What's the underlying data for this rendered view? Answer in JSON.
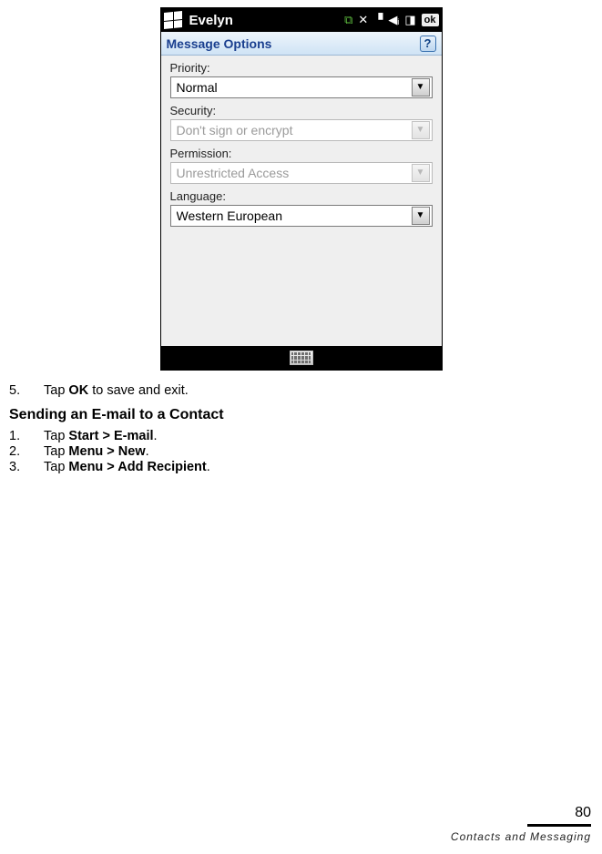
{
  "device": {
    "statusbar": {
      "title": "Evelyn",
      "ok": "ok"
    },
    "titlebar": {
      "title": "Message Options",
      "help": "?"
    },
    "fields": {
      "priority": {
        "label": "Priority:",
        "value": "Normal",
        "enabled": true
      },
      "security": {
        "label": "Security:",
        "value": "Don't sign or encrypt",
        "enabled": false
      },
      "permission": {
        "label": "Permission:",
        "value": "Unrestricted Access",
        "enabled": false
      },
      "language": {
        "label": "Language:",
        "value": "Western European",
        "enabled": true
      }
    }
  },
  "body": {
    "prev_step": {
      "num": "5.",
      "pre": "Tap ",
      "bold": "OK",
      "post": " to save and exit."
    },
    "heading": "Sending an E-mail to a Contact",
    "steps": [
      {
        "num": "1.",
        "pre": "Tap ",
        "bold": "Start > E-mail",
        "post": "."
      },
      {
        "num": "2.",
        "pre": "Tap ",
        "bold": "Menu > New",
        "post": "."
      },
      {
        "num": "3.",
        "pre": "Tap ",
        "bold": "Menu > Add Recipient",
        "post": "."
      }
    ]
  },
  "footer": {
    "page": "80",
    "section": "Contacts and Messaging"
  }
}
